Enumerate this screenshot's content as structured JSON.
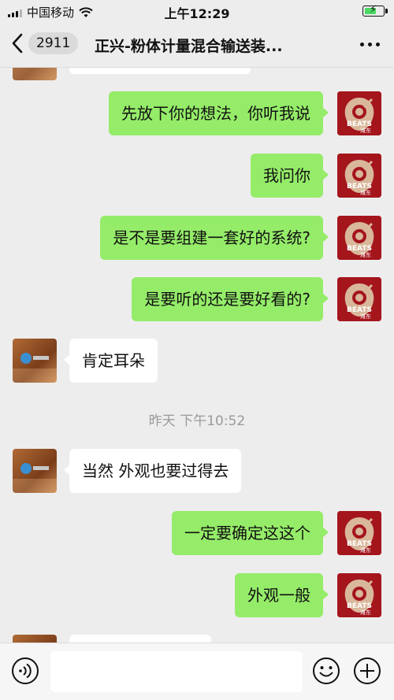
{
  "status_bar": {
    "carrier": "中国移动",
    "time": "上午12:29",
    "battery_icon": "battery-charging-icon",
    "battery_color": "#4cd964"
  },
  "nav": {
    "unread_count": "2911",
    "title": "正兴-粉体计量混合输送装..."
  },
  "colors": {
    "outgoing_bubble": "#95ec69",
    "incoming_bubble": "#ffffff",
    "background": "#ededed"
  },
  "messages": [
    {
      "side": "in",
      "text": ""
    },
    {
      "side": "out",
      "text": "先放下你的想法，你听我说"
    },
    {
      "side": "out",
      "text": "我问你"
    },
    {
      "side": "out",
      "text": "是不是要组建一套好的系统?"
    },
    {
      "side": "out",
      "text": "是要听的还是要好看的?"
    },
    {
      "side": "in",
      "text": "肯定耳朵"
    },
    {
      "side": "in",
      "text": "当然 外观也要过得去"
    },
    {
      "side": "out",
      "text": "一定要确定这这个"
    },
    {
      "side": "out",
      "text": "外观一般"
    },
    {
      "side": "in",
      "text": ""
    }
  ],
  "time_separator": "昨天 下午10:52",
  "avatar_text": "BEATS",
  "avatar_sub": "潍东",
  "input": {
    "value": "",
    "placeholder": ""
  }
}
